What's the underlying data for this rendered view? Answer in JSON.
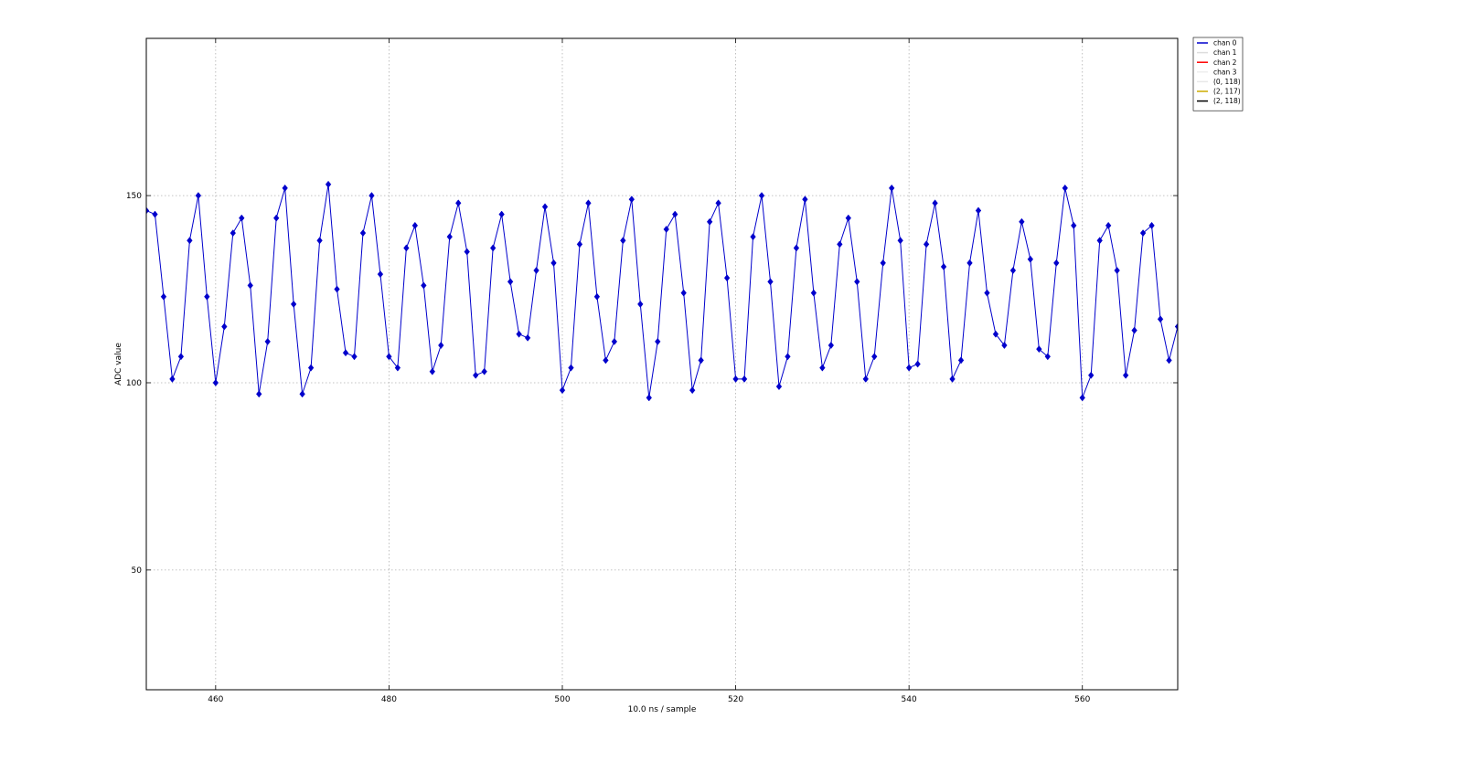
{
  "chart_data": {
    "type": "line",
    "title": "",
    "xlabel": "10.0 ns / sample",
    "ylabel": "ADC value",
    "xlim": [
      452,
      571
    ],
    "ylim": [
      18,
      192
    ],
    "xticks": [
      460,
      480,
      500,
      520,
      540,
      560
    ],
    "yticks": [
      50,
      100,
      150
    ],
    "grid": true,
    "legend_position": "outside-top-right",
    "legend": [
      {
        "label": "chan 0",
        "color": "#0000cc"
      },
      {
        "label": "chan 1",
        "color": "#dddddd"
      },
      {
        "label": "chan 2",
        "color": "#ff0000"
      },
      {
        "label": "chan 3",
        "color": "#eeeeee"
      },
      {
        "label": "(0, 118)",
        "color": "#e8e8e8"
      },
      {
        "label": "(2, 117)",
        "color": "#ccaa00"
      },
      {
        "label": "(2, 118)",
        "color": "#000000"
      }
    ],
    "series": [
      {
        "name": "chan 0",
        "color": "#0000cc",
        "x_start": 452,
        "values": [
          146,
          145,
          123,
          101,
          107,
          138,
          150,
          123,
          100,
          115,
          140,
          144,
          126,
          97,
          111,
          144,
          152,
          121,
          97,
          104,
          138,
          153,
          125,
          108,
          107,
          140,
          150,
          129,
          107,
          104,
          136,
          142,
          126,
          103,
          110,
          139,
          148,
          135,
          102,
          103,
          136,
          145,
          127,
          113,
          112,
          130,
          147,
          132,
          98,
          104,
          137,
          148,
          123,
          106,
          111,
          138,
          149,
          121,
          96,
          111,
          141,
          145,
          124,
          98,
          106,
          143,
          148,
          128,
          101,
          101,
          139,
          150,
          127,
          99,
          107,
          136,
          149,
          124,
          104,
          110,
          137,
          144,
          127,
          101,
          107,
          132,
          152,
          138,
          104,
          105,
          137,
          148,
          131,
          101,
          106,
          132,
          146,
          124,
          113,
          110,
          130,
          143,
          133,
          109,
          107,
          132,
          152,
          142,
          96,
          102,
          138,
          142,
          130,
          102,
          114,
          140,
          142,
          117,
          106,
          115
        ]
      }
    ]
  }
}
